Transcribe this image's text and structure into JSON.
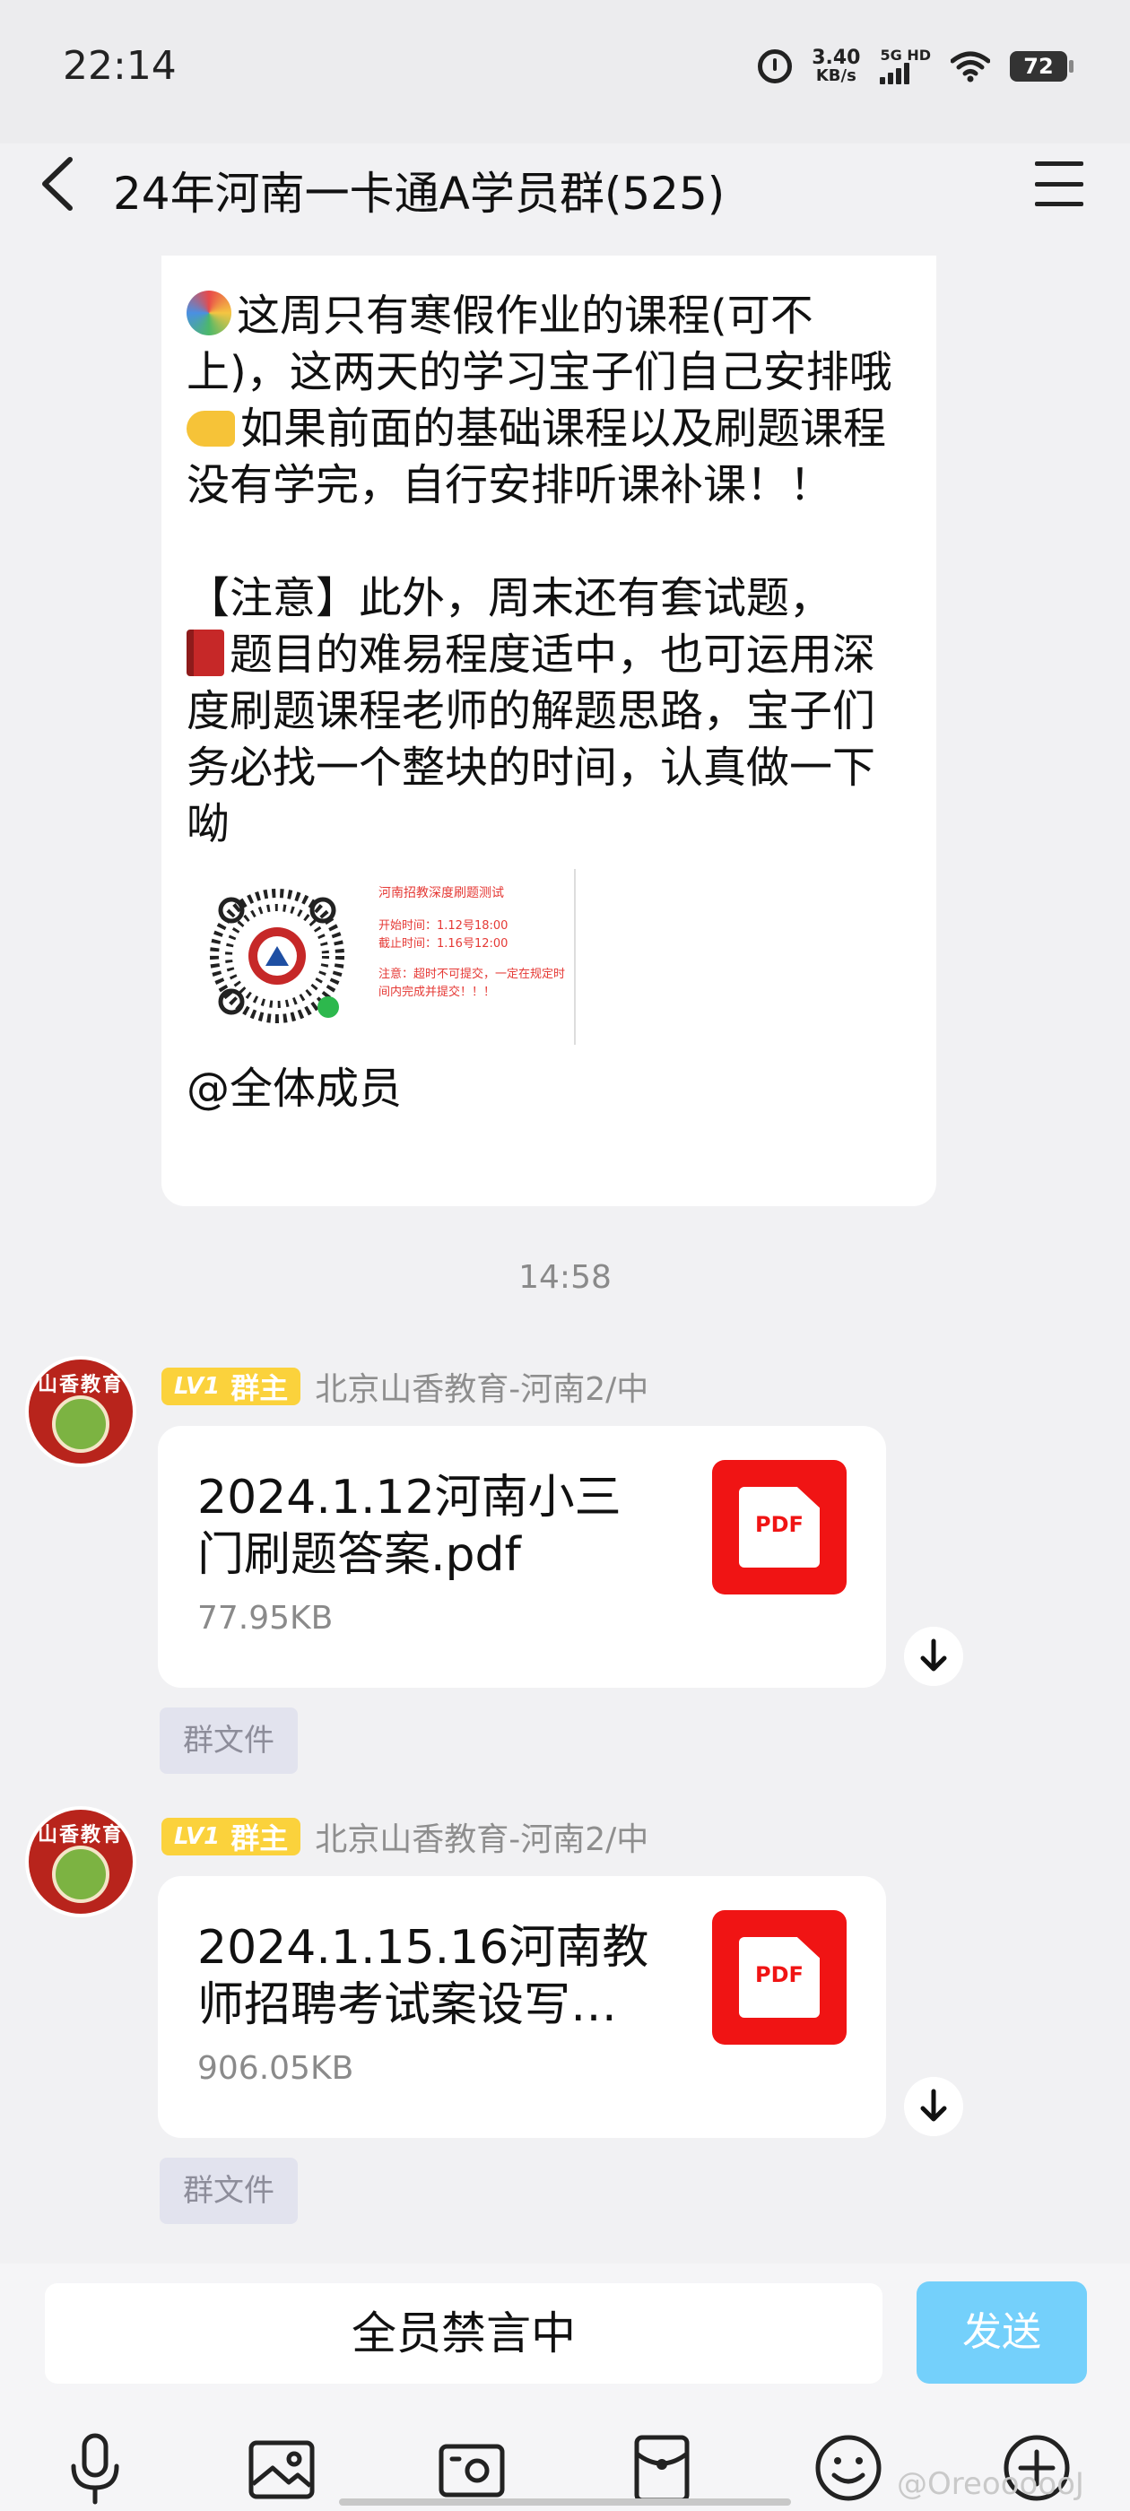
{
  "status_bar": {
    "time": "22:14",
    "net_speed_value": "3.40",
    "net_speed_unit": "KB/s",
    "network_label": "5G HD",
    "battery": "72"
  },
  "header": {
    "title": "24年河南一卡通A学员群(525)"
  },
  "message_1": {
    "lines": [
      "这周只有寒假作业的课程(可不上)，这两天的学习宝子们自己安排哦",
      "如果前面的基础课程以及刷题课程没有学完，自行安排听课补课！！",
      "",
      "【注意】此外，周末还有套试题，",
      "题目的难易程度适中，也可运用深度刷题课程老师的解题思路，宝子们务必找一个整块的时间，认真做一下呦"
    ],
    "poster": {
      "title": "河南招教深度刷题测试",
      "start": "开始时间：1.12号18:00",
      "end": "截止时间：1.16号12:00",
      "note": "注意：超时不可提交，一定在规定时间内完成并提交！！！"
    },
    "mention": "@全体成员"
  },
  "timestamp": "14:58",
  "file_messages": [
    {
      "level": "LV1",
      "role": "群主",
      "sender": "北京山香教育-河南2/中",
      "file_name": "2024.1.12河南小三门刷题答案.pdf",
      "file_size": "77.95KB",
      "file_type": "PDF",
      "tag": "群文件"
    },
    {
      "level": "LV1",
      "role": "群主",
      "sender": "北京山香教育-河南2/中",
      "file_name": "2024.1.15.16河南教师招聘考试案设写…",
      "file_size": "906.05KB",
      "file_type": "PDF",
      "tag": "群文件"
    }
  ],
  "avatar_text": "山香教育",
  "input": {
    "muted_text": "全员禁言中",
    "send_label": "发送"
  },
  "toolbar_icons": [
    "microphone-icon",
    "image-icon",
    "camera-icon",
    "red-packet-icon",
    "emoji-icon",
    "plus-icon"
  ],
  "watermark": "@OreoooooJ",
  "colors": {
    "accent_send": "#74d0fb",
    "pdf_red": "#f01414",
    "badge_yellow": "#fbd23c"
  }
}
